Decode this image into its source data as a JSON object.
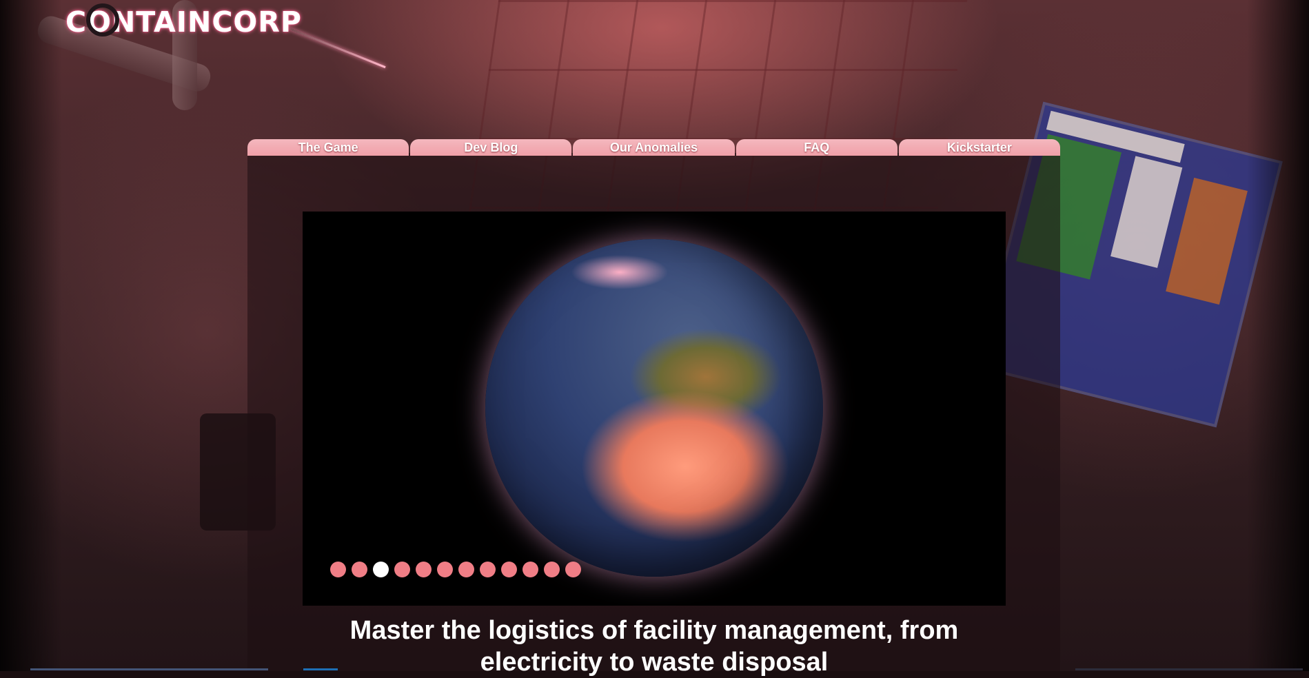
{
  "brand": {
    "logo_text": "CONTAINCORP"
  },
  "nav": {
    "items": [
      {
        "label": "The Game"
      },
      {
        "label": "Dev Blog"
      },
      {
        "label": "Our Anomalies"
      },
      {
        "label": "FAQ"
      },
      {
        "label": "Kickstarter"
      }
    ]
  },
  "slider": {
    "slide_count": 12,
    "active_index": 2
  },
  "tagline": "Master the logistics of facility management, from electricity to waste disposal",
  "colors": {
    "nav_tab": "#f4b8be",
    "dot": "#f07e86",
    "dot_active": "#ffffff",
    "glow": "#ff6f9a"
  }
}
